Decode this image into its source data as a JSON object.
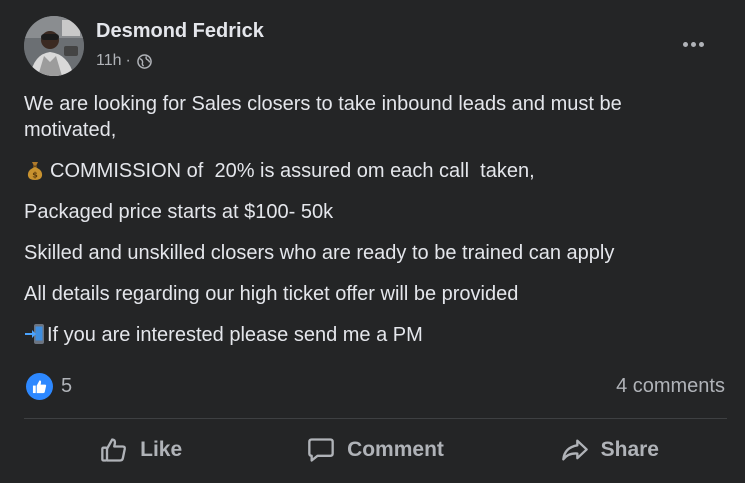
{
  "post": {
    "author": "Desmond Fedrick",
    "timestamp": "11h",
    "separator": "·",
    "privacy_icon": "globe-icon",
    "avatar_icon": "profile-avatar",
    "more_icon": "more-options-icon",
    "lines": [
      {
        "emoji": null,
        "text": "We are looking for Sales closers to take inbound leads and must be motivated,"
      },
      {
        "emoji": "money-bag-emoji",
        "text": "COMMISSION of  20% is assured om each call  taken,"
      },
      {
        "emoji": null,
        "text": "Packaged price starts at $100- 50k"
      },
      {
        "emoji": null,
        "text": "Skilled and unskilled closers who are ready to be trained can apply"
      },
      {
        "emoji": null,
        "text": "All details regarding our high ticket offer will be provided"
      },
      {
        "emoji": "mobile-phone-arrow-emoji",
        "text": "If you are interested please send me a PM"
      }
    ],
    "reaction_count": "5",
    "comments_count": "4 comments"
  },
  "actions": {
    "like": "Like",
    "comment": "Comment",
    "share": "Share"
  },
  "colors": {
    "background": "#242526",
    "text_primary": "#e4e6eb",
    "text_secondary": "#b0b3b8",
    "like_blue": "#2d88ff",
    "divider": "#3e4042"
  }
}
